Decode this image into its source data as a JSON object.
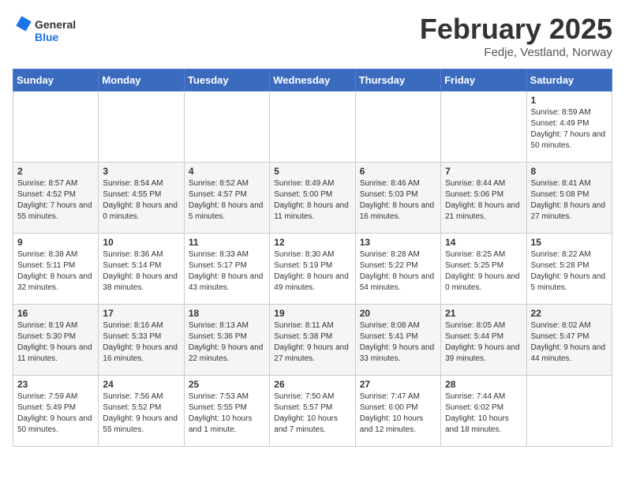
{
  "header": {
    "logo_line1": "General",
    "logo_line2": "Blue",
    "title": "February 2025",
    "subtitle": "Fedje, Vestland, Norway"
  },
  "days_of_week": [
    "Sunday",
    "Monday",
    "Tuesday",
    "Wednesday",
    "Thursday",
    "Friday",
    "Saturday"
  ],
  "weeks": [
    [
      {
        "day": "",
        "info": ""
      },
      {
        "day": "",
        "info": ""
      },
      {
        "day": "",
        "info": ""
      },
      {
        "day": "",
        "info": ""
      },
      {
        "day": "",
        "info": ""
      },
      {
        "day": "",
        "info": ""
      },
      {
        "day": "1",
        "info": "Sunrise: 8:59 AM\nSunset: 4:49 PM\nDaylight: 7 hours and 50 minutes."
      }
    ],
    [
      {
        "day": "2",
        "info": "Sunrise: 8:57 AM\nSunset: 4:52 PM\nDaylight: 7 hours and 55 minutes."
      },
      {
        "day": "3",
        "info": "Sunrise: 8:54 AM\nSunset: 4:55 PM\nDaylight: 8 hours and 0 minutes."
      },
      {
        "day": "4",
        "info": "Sunrise: 8:52 AM\nSunset: 4:57 PM\nDaylight: 8 hours and 5 minutes."
      },
      {
        "day": "5",
        "info": "Sunrise: 8:49 AM\nSunset: 5:00 PM\nDaylight: 8 hours and 11 minutes."
      },
      {
        "day": "6",
        "info": "Sunrise: 8:46 AM\nSunset: 5:03 PM\nDaylight: 8 hours and 16 minutes."
      },
      {
        "day": "7",
        "info": "Sunrise: 8:44 AM\nSunset: 5:06 PM\nDaylight: 8 hours and 21 minutes."
      },
      {
        "day": "8",
        "info": "Sunrise: 8:41 AM\nSunset: 5:08 PM\nDaylight: 8 hours and 27 minutes."
      }
    ],
    [
      {
        "day": "9",
        "info": "Sunrise: 8:38 AM\nSunset: 5:11 PM\nDaylight: 8 hours and 32 minutes."
      },
      {
        "day": "10",
        "info": "Sunrise: 8:36 AM\nSunset: 5:14 PM\nDaylight: 8 hours and 38 minutes."
      },
      {
        "day": "11",
        "info": "Sunrise: 8:33 AM\nSunset: 5:17 PM\nDaylight: 8 hours and 43 minutes."
      },
      {
        "day": "12",
        "info": "Sunrise: 8:30 AM\nSunset: 5:19 PM\nDaylight: 8 hours and 49 minutes."
      },
      {
        "day": "13",
        "info": "Sunrise: 8:28 AM\nSunset: 5:22 PM\nDaylight: 8 hours and 54 minutes."
      },
      {
        "day": "14",
        "info": "Sunrise: 8:25 AM\nSunset: 5:25 PM\nDaylight: 9 hours and 0 minutes."
      },
      {
        "day": "15",
        "info": "Sunrise: 8:22 AM\nSunset: 5:28 PM\nDaylight: 9 hours and 5 minutes."
      }
    ],
    [
      {
        "day": "16",
        "info": "Sunrise: 8:19 AM\nSunset: 5:30 PM\nDaylight: 9 hours and 11 minutes."
      },
      {
        "day": "17",
        "info": "Sunrise: 8:16 AM\nSunset: 5:33 PM\nDaylight: 9 hours and 16 minutes."
      },
      {
        "day": "18",
        "info": "Sunrise: 8:13 AM\nSunset: 5:36 PM\nDaylight: 9 hours and 22 minutes."
      },
      {
        "day": "19",
        "info": "Sunrise: 8:11 AM\nSunset: 5:38 PM\nDaylight: 9 hours and 27 minutes."
      },
      {
        "day": "20",
        "info": "Sunrise: 8:08 AM\nSunset: 5:41 PM\nDaylight: 9 hours and 33 minutes."
      },
      {
        "day": "21",
        "info": "Sunrise: 8:05 AM\nSunset: 5:44 PM\nDaylight: 9 hours and 39 minutes."
      },
      {
        "day": "22",
        "info": "Sunrise: 8:02 AM\nSunset: 5:47 PM\nDaylight: 9 hours and 44 minutes."
      }
    ],
    [
      {
        "day": "23",
        "info": "Sunrise: 7:59 AM\nSunset: 5:49 PM\nDaylight: 9 hours and 50 minutes."
      },
      {
        "day": "24",
        "info": "Sunrise: 7:56 AM\nSunset: 5:52 PM\nDaylight: 9 hours and 55 minutes."
      },
      {
        "day": "25",
        "info": "Sunrise: 7:53 AM\nSunset: 5:55 PM\nDaylight: 10 hours and 1 minute."
      },
      {
        "day": "26",
        "info": "Sunrise: 7:50 AM\nSunset: 5:57 PM\nDaylight: 10 hours and 7 minutes."
      },
      {
        "day": "27",
        "info": "Sunrise: 7:47 AM\nSunset: 6:00 PM\nDaylight: 10 hours and 12 minutes."
      },
      {
        "day": "28",
        "info": "Sunrise: 7:44 AM\nSunset: 6:02 PM\nDaylight: 10 hours and 18 minutes."
      },
      {
        "day": "",
        "info": ""
      }
    ]
  ]
}
